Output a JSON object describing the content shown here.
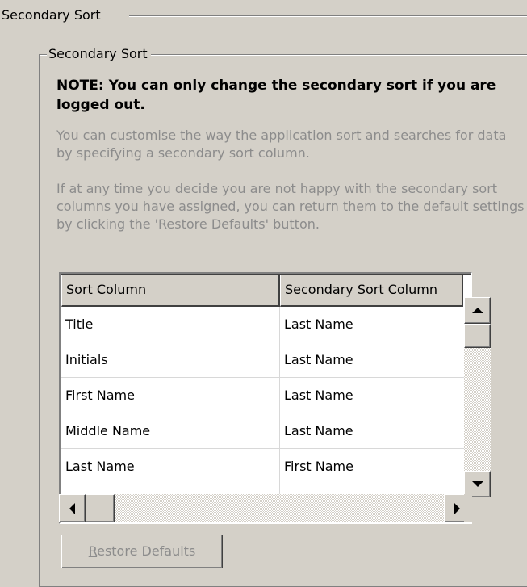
{
  "outer_group": {
    "title": "Secondary Sort"
  },
  "group": {
    "title": "Secondary Sort",
    "note": "NOTE: You can only change the secondary sort if you are logged out.",
    "paragraph1": "You can customise the way the application sort and searches for data by specifying a secondary sort column.",
    "paragraph2": "If at any time you decide you are not happy with the secondary sort columns you have assigned, you can return them to the default settings by clicking the 'Restore Defaults' button."
  },
  "grid": {
    "columns": [
      "Sort Column",
      "Secondary Sort Column"
    ],
    "rows": [
      [
        "Title",
        "Last Name"
      ],
      [
        "Initials",
        "Last Name"
      ],
      [
        "First Name",
        "Last Name"
      ],
      [
        "Middle Name",
        "Last Name"
      ],
      [
        "Last Name",
        "First Name"
      ],
      [
        "",
        ""
      ]
    ]
  },
  "restore_button": {
    "accel": "R",
    "rest": "estore Defaults"
  },
  "colors": {
    "background": "#d4d0c8",
    "disabled_text": "#8c8c8c"
  },
  "icons": {
    "scroll_up": "triangle-up-icon",
    "scroll_down": "triangle-down-icon",
    "scroll_left": "triangle-left-icon",
    "scroll_right": "triangle-right-icon"
  }
}
